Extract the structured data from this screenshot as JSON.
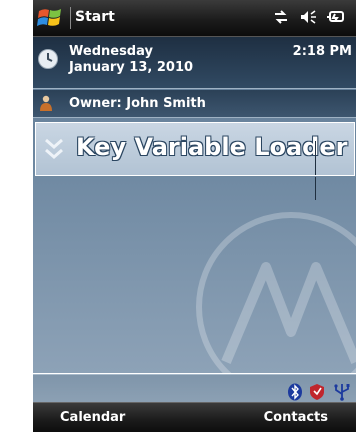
{
  "taskbar": {
    "start_label": "Start",
    "status_icons": [
      "data-connection-icon",
      "speaker-icon",
      "battery-charging-icon"
    ]
  },
  "today": {
    "date_line1": "Wednesday",
    "date_line2": "January 13, 2010",
    "time": "2:18 PM",
    "owner": "Owner: John Smith",
    "app_title": "Key Variable Loader"
  },
  "notifications": [
    "bluetooth-icon",
    "shield-icon",
    "usb-icon"
  ],
  "softkeys": {
    "left": "Calendar",
    "right": "Contacts"
  },
  "colors": {
    "title_bar": "#1c1c1c",
    "home_background": "#6f89a2",
    "selected_row": "#c9d6e3"
  }
}
